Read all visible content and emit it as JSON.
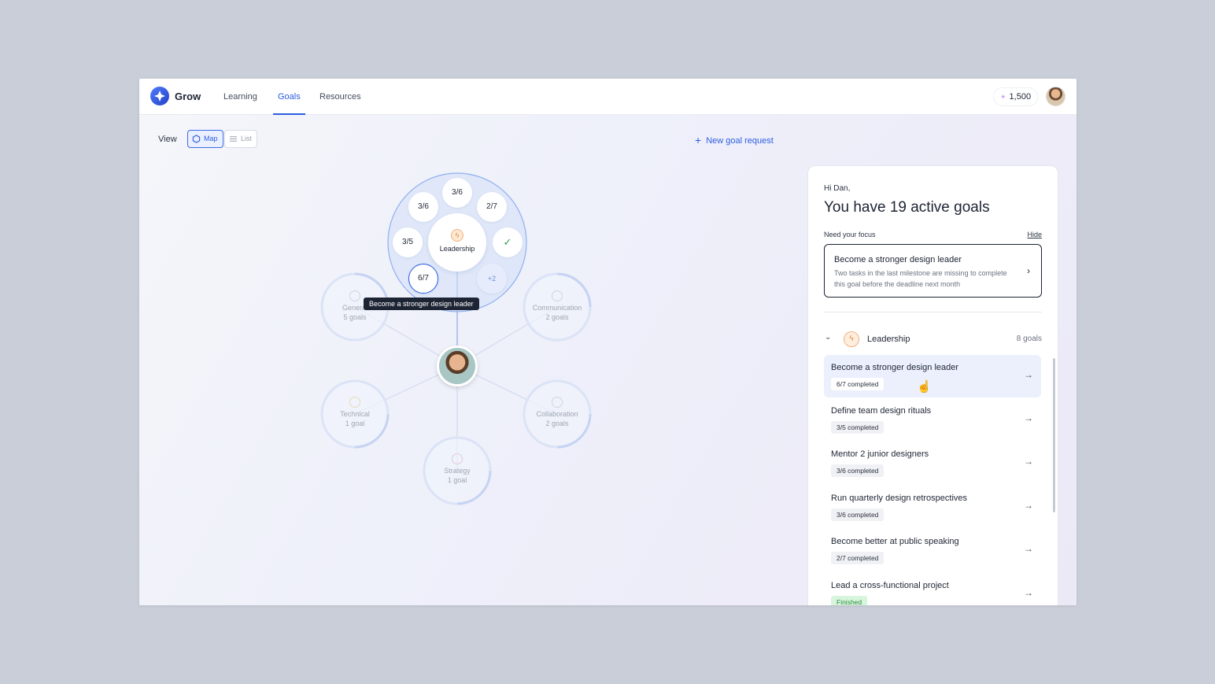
{
  "app": {
    "brand": "Grow"
  },
  "nav": [
    {
      "label": "Learning",
      "active": false
    },
    {
      "label": "Goals",
      "active": true
    },
    {
      "label": "Resources",
      "active": false
    }
  ],
  "points": {
    "value": "1,500"
  },
  "view": {
    "label": "View",
    "options": [
      "Map",
      "List"
    ],
    "selected": "Map"
  },
  "new_goal": {
    "label": "New goal request"
  },
  "map": {
    "center_label": "Leadership",
    "tooltip": "Become a stronger design leader",
    "progress_chips": [
      "3/6",
      "3/6",
      "2/7",
      "3/5",
      "6/7",
      "+2"
    ],
    "categories": [
      {
        "name": "General",
        "count": "5 goals"
      },
      {
        "name": "Communication",
        "count": "2 goals"
      },
      {
        "name": "Technical",
        "count": "1 goal"
      },
      {
        "name": "Collaboration",
        "count": "2 goals"
      },
      {
        "name": "Strategy",
        "count": "1 goal"
      }
    ]
  },
  "panel": {
    "greeting": "Hi Dan,",
    "title": "You have 19 active goals",
    "focus_label": "Need your focus",
    "hide_label": "Hide",
    "focus_card": {
      "title": "Become a stronger design leader",
      "description": "Two tasks in the last milestone are missing to complete this goal before the deadline next month"
    },
    "group": {
      "name": "Leadership",
      "count": "8 goals"
    },
    "goals": [
      {
        "title": "Become a stronger design leader",
        "status": "6/7 completed"
      },
      {
        "title": "Define team design rituals",
        "status": "3/5 completed"
      },
      {
        "title": "Mentor 2 junior designers",
        "status": "3/6 completed"
      },
      {
        "title": "Run quarterly design retrospectives",
        "status": "3/6 completed"
      },
      {
        "title": "Become better at public speaking",
        "status": "2/7 completed"
      },
      {
        "title": "Lead a cross-functional project",
        "status": "Finished"
      }
    ]
  },
  "colors": {
    "accent": "#2d5de0",
    "finished": "#2a8a3e"
  }
}
